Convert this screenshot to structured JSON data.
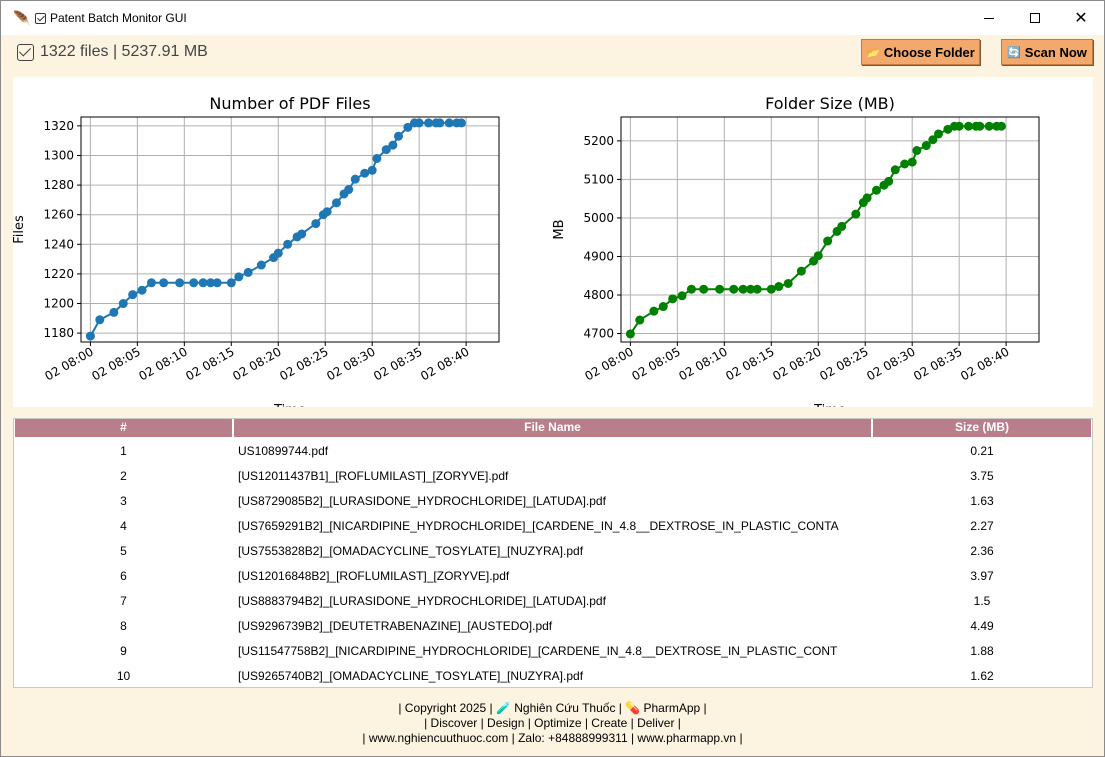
{
  "window": {
    "title": "Patent Batch Monitor GUI",
    "app_icon": "feather-icon"
  },
  "toolbar": {
    "status_text": "1322 files | 5237.91 MB",
    "choose_folder_label": "Choose Folder",
    "scan_now_label": "Scan Now"
  },
  "charts": {
    "files": {
      "title": "Number of PDF Files",
      "ylabel": "Files",
      "xlabel": "Time",
      "color": "#1f77b4"
    },
    "size": {
      "title": "Folder Size (MB)",
      "ylabel": "MB",
      "xlabel": "Time",
      "color": "#008000"
    }
  },
  "chart_data": [
    {
      "type": "line",
      "title": "Number of PDF Files",
      "xlabel": "Time",
      "ylabel": "Files",
      "x_ticks": [
        "02 08:00",
        "02 08:05",
        "02 08:10",
        "02 08:15",
        "02 08:20",
        "02 08:25",
        "02 08:30",
        "02 08:35",
        "02 08:40"
      ],
      "y_ticks": [
        1180,
        1200,
        1220,
        1240,
        1260,
        1280,
        1300,
        1320
      ],
      "ylim": [
        1174,
        1326
      ],
      "xlim_minutes": [
        -1.0,
        43.5
      ],
      "grid": true,
      "minutes": [
        0,
        1,
        2.5,
        3.5,
        4.5,
        5.5,
        6.5,
        7.8,
        9.5,
        11,
        12,
        12.8,
        13.5,
        15,
        15.8,
        16.8,
        18.2,
        19.5,
        20,
        21,
        22,
        22.5,
        24,
        24.8,
        25.2,
        26.2,
        27,
        27.5,
        28.2,
        29.2,
        30,
        30.5,
        31.5,
        32.2,
        32.8,
        33.8,
        34.5,
        35,
        36,
        36.8,
        37.2,
        38.2,
        39,
        39.5
      ],
      "values": [
        1178,
        1189,
        1194,
        1200,
        1206,
        1209,
        1214,
        1214,
        1214,
        1214,
        1214,
        1214,
        1214,
        1214,
        1218,
        1221,
        1226,
        1231,
        1234,
        1240,
        1245,
        1247,
        1254,
        1260,
        1262,
        1268,
        1274,
        1277,
        1284,
        1288,
        1290,
        1298,
        1304,
        1307,
        1313,
        1319,
        1322,
        1322,
        1322,
        1322,
        1322,
        1322,
        1322,
        1322
      ]
    },
    {
      "type": "line",
      "title": "Folder Size (MB)",
      "xlabel": "Time",
      "ylabel": "MB",
      "x_ticks": [
        "02 08:00",
        "02 08:05",
        "02 08:10",
        "02 08:15",
        "02 08:20",
        "02 08:25",
        "02 08:30",
        "02 08:35",
        "02 08:40"
      ],
      "y_ticks": [
        4700,
        4800,
        4900,
        5000,
        5100,
        5200
      ],
      "ylim": [
        4678,
        5262
      ],
      "xlim_minutes": [
        -1.0,
        43.5
      ],
      "grid": true,
      "minutes": [
        0,
        1,
        2.5,
        3.5,
        4.5,
        5.5,
        6.5,
        7.8,
        9.5,
        11,
        12,
        12.8,
        13.5,
        15,
        15.8,
        16.8,
        18.2,
        19.5,
        20,
        21,
        22,
        22.5,
        24,
        24.8,
        25.2,
        26.2,
        27,
        27.5,
        28.2,
        29.2,
        30,
        30.5,
        31.5,
        32.2,
        32.8,
        33.8,
        34.5,
        35,
        36,
        36.8,
        37.2,
        38.2,
        39,
        39.5
      ],
      "values": [
        4699,
        4735,
        4758,
        4770,
        4790,
        4798,
        4815,
        4815,
        4815,
        4815,
        4815,
        4815,
        4815,
        4815,
        4822,
        4830,
        4862,
        4888,
        4902,
        4940,
        4965,
        4978,
        5010,
        5040,
        5052,
        5072,
        5085,
        5095,
        5125,
        5140,
        5145,
        5175,
        5188,
        5203,
        5218,
        5230,
        5238,
        5238,
        5238,
        5238,
        5238,
        5238,
        5238,
        5238
      ]
    }
  ],
  "table": {
    "headers": [
      "#",
      "File Name",
      "Size (MB)"
    ],
    "rows": [
      {
        "num": "1",
        "name": "US10899744.pdf",
        "size": "0.21"
      },
      {
        "num": "2",
        "name": "[US12011437B1]_[ROFLUMILAST]_[ZORYVE].pdf",
        "size": "3.75"
      },
      {
        "num": "3",
        "name": "[US8729085B2]_[LURASIDONE_HYDROCHLORIDE]_[LATUDA].pdf",
        "size": "1.63"
      },
      {
        "num": "4",
        "name": "[US7659291B2]_[NICARDIPINE_HYDROCHLORIDE]_[CARDENE_IN_4.8__DEXTROSE_IN_PLASTIC_CONTA",
        "size": "2.27"
      },
      {
        "num": "5",
        "name": "[US7553828B2]_[OMADACYCLINE_TOSYLATE]_[NUZYRA].pdf",
        "size": "2.36"
      },
      {
        "num": "6",
        "name": "[US12016848B2]_[ROFLUMILAST]_[ZORYVE].pdf",
        "size": "3.97"
      },
      {
        "num": "7",
        "name": "[US8883794B2]_[LURASIDONE_HYDROCHLORIDE]_[LATUDA].pdf",
        "size": "1.5"
      },
      {
        "num": "8",
        "name": "[US9296739B2]_[DEUTETRABENAZINE]_[AUSTEDO].pdf",
        "size": "4.49"
      },
      {
        "num": "9",
        "name": "[US11547758B2]_[NICARDIPINE_HYDROCHLORIDE]_[CARDENE_IN_4.8__DEXTROSE_IN_PLASTIC_CONT",
        "size": "1.88"
      },
      {
        "num": "10",
        "name": "[US9265740B2]_[OMADACYCLINE_TOSYLATE]_[NUZYRA].pdf",
        "size": "1.62"
      }
    ]
  },
  "footer": {
    "line1": "| Copyright 2025 | 🧪 Nghiên Cứu Thuốc | 💊 PharmApp |",
    "line2": "| Discover | Design | Optimize | Create | Deliver |",
    "line3": "| www.nghiencuuthuoc.com | Zalo: +84888999311 | www.pharmapp.vn |"
  }
}
